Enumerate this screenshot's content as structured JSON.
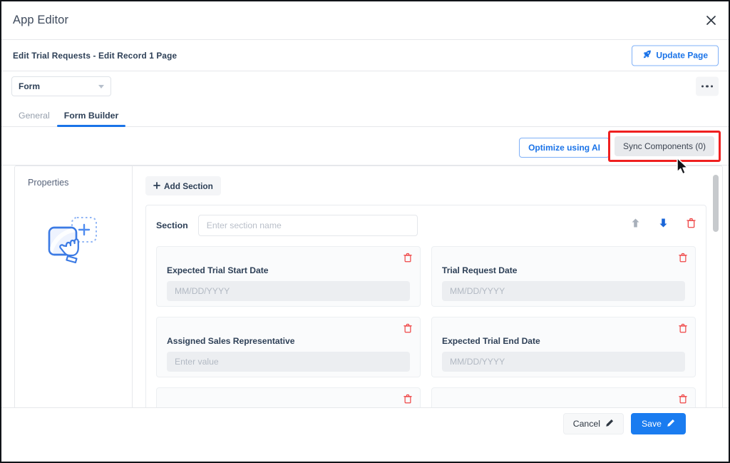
{
  "window": {
    "title": "App Editor",
    "close_icon": "close-icon"
  },
  "breadcrumb": {
    "text": "Edit  Trial Requests  -  Edit Record 1  Page"
  },
  "header_actions": {
    "update_page_label": "Update Page",
    "update_page_icon": "rocket-icon",
    "more_icon": "ellipsis-icon"
  },
  "type_select": {
    "value": "Form",
    "caret_icon": "chevron-down-icon"
  },
  "tabs": [
    {
      "label": "General",
      "active": false
    },
    {
      "label": "Form Builder",
      "active": true
    }
  ],
  "toolbar": {
    "optimize_label": "Optimize using AI",
    "sync_label": "Sync Components (0)",
    "sync_highlight_color": "#ef2020",
    "sync_disabled_bg": "#e8eaed"
  },
  "properties_panel": {
    "title": "Properties",
    "illustration_icon": "drag-drop-illustration-icon"
  },
  "canvas": {
    "add_section_label": "Add Section",
    "add_section_icon": "plus-icon",
    "section": {
      "label": "Section",
      "name_value": "",
      "name_placeholder": "Enter section name",
      "move_up_icon": "arrow-up-icon",
      "move_down_icon": "arrow-down-icon",
      "delete_icon": "trash-icon"
    },
    "fields": [
      {
        "label": "Expected Trial Start Date",
        "value": "",
        "placeholder": "MM/DD/YYYY",
        "delete_icon": "trash-icon"
      },
      {
        "label": "Trial Request Date",
        "value": "",
        "placeholder": "MM/DD/YYYY",
        "delete_icon": "trash-icon"
      },
      {
        "label": "Assigned Sales Representative",
        "value": "",
        "placeholder": "Enter value",
        "delete_icon": "trash-icon"
      },
      {
        "label": "Expected Trial End Date",
        "value": "",
        "placeholder": "MM/DD/YYYY",
        "delete_icon": "trash-icon"
      },
      {
        "label": "",
        "value": "",
        "placeholder": "",
        "delete_icon": "trash-icon"
      },
      {
        "label": "",
        "value": "",
        "placeholder": "",
        "delete_icon": "trash-icon"
      }
    ]
  },
  "footer": {
    "cancel_label": "Cancel",
    "cancel_icon": "pencil-icon",
    "save_label": "Save",
    "save_icon": "pencil-icon",
    "save_color": "#1a7cf0"
  },
  "colors": {
    "accent": "#1a73e8",
    "danger": "#ef4444",
    "text": "#2e4057"
  }
}
